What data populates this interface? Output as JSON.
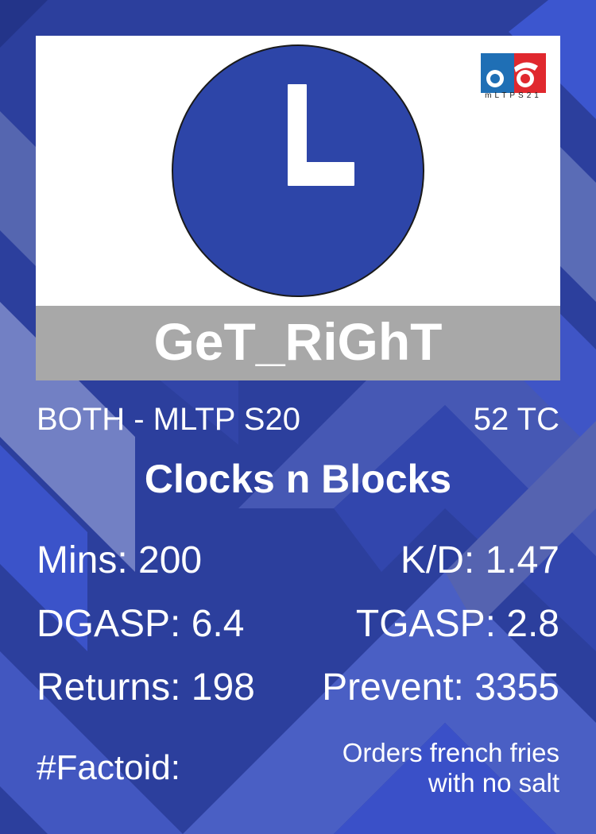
{
  "player": {
    "name": "GeT_RiGhT",
    "league": "BOTH - MLTP S20",
    "tc": "52 TC",
    "team": "Clocks n Blocks"
  },
  "logo": {
    "text": "mLTPS21",
    "icon": "mltp-logo-icon"
  },
  "stats": {
    "mins": "Mins: 200",
    "kd": "K/D: 1.47",
    "dgasp": "DGASP: 6.4",
    "tgasp": "TGASP: 2.8",
    "returns": "Returns: 198",
    "prevent": "Prevent: 3355"
  },
  "factoid": {
    "label": "#Factoid:",
    "line1": "Orders french fries",
    "line2": "with no salt"
  },
  "colors": {
    "background": "#2c3f9d",
    "clock_face": "#2d45a8",
    "name_bar": "#a8a8a8",
    "logo_blue": "#1f6fb5",
    "logo_red": "#e0282e"
  }
}
